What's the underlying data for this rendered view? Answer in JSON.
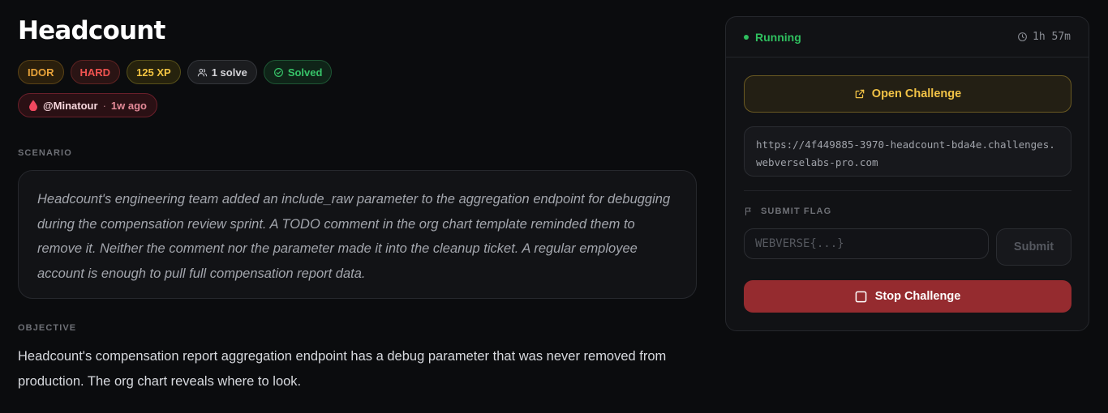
{
  "challenge": {
    "title": "Headcount",
    "tags": {
      "category": "IDOR",
      "difficulty": "HARD",
      "xp": "125 XP",
      "solves": "1 solve",
      "solved": "Solved"
    },
    "first_blood": {
      "user": "@Minatour",
      "separator": "·",
      "time_ago": "1w ago"
    },
    "scenario_label": "SCENARIO",
    "scenario": "Headcount's engineering team added an include_raw parameter to the aggregation endpoint for debugging during the compensation review sprint. A TODO comment in the org chart template reminded them to remove it. Neither the comment nor the parameter made it into the cleanup ticket. A regular employee account is enough to pull full compensation report data.",
    "objective_label": "OBJECTIVE",
    "objective": "Headcount's compensation report aggregation endpoint has a debug parameter that was never removed from production. The org chart reveals where to look."
  },
  "panel": {
    "status": "Running",
    "timer": "1h 57m",
    "open_button": "Open Challenge",
    "url": "https://4f449885-3970-headcount-bda4e.challenges.webverselabs-pro.com",
    "flag_label": "SUBMIT FLAG",
    "flag_placeholder": "WEBVERSE{...}",
    "submit_button": "Submit",
    "stop_button": "Stop Challenge"
  },
  "colors": {
    "accent_gold": "#f1c246",
    "running_green": "#2fbf5f",
    "stop_red": "#952b2f"
  }
}
